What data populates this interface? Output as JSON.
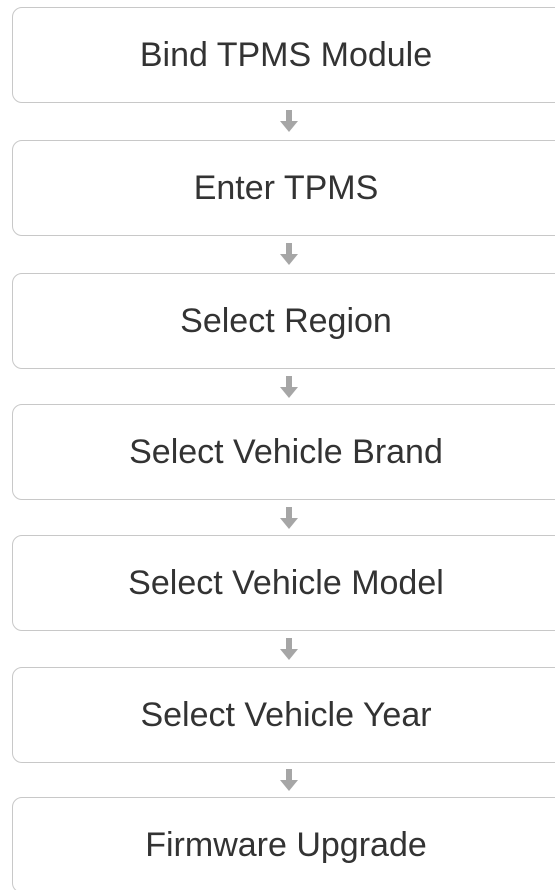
{
  "flowchart": {
    "steps": [
      {
        "label": "Bind TPMS Module"
      },
      {
        "label": "Enter TPMS"
      },
      {
        "label": "Select Region"
      },
      {
        "label": "Select Vehicle Brand"
      },
      {
        "label": "Select Vehicle Model"
      },
      {
        "label": "Select Vehicle Year"
      },
      {
        "label": "Firmware Upgrade"
      }
    ],
    "arrow_icon": "arrow-down-icon",
    "colors": {
      "box_border": "#c8c8c8",
      "text": "#333333",
      "arrow": "#a6a6a6"
    }
  }
}
